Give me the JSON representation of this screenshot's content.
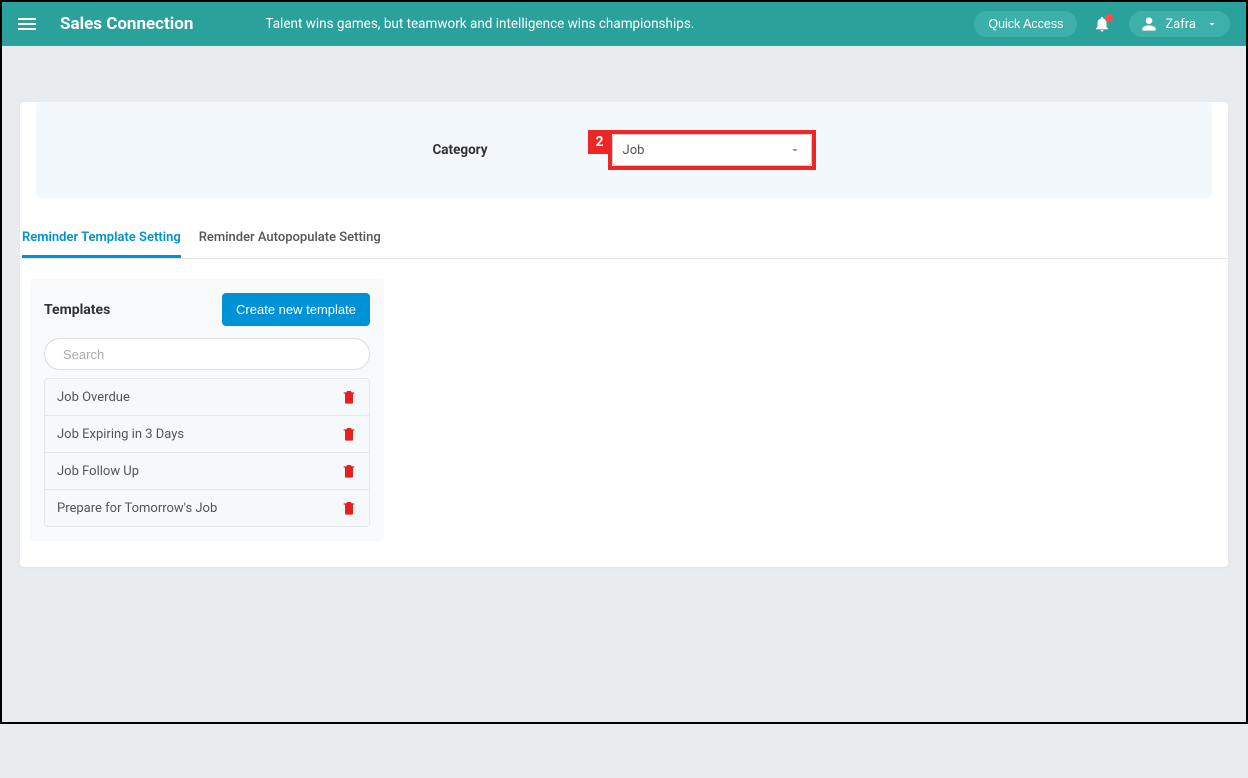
{
  "header": {
    "brand": "Sales Connection",
    "tagline": "Talent wins games, but teamwork and intelligence wins championships.",
    "quick_access_label": "Quick Access",
    "user_name": "Zafra"
  },
  "category_section": {
    "label": "Category",
    "selected_value": "Job",
    "callout_number": "2"
  },
  "tabs": [
    {
      "label": "Reminder Template Setting",
      "active": true
    },
    {
      "label": "Reminder Autopopulate Setting",
      "active": false
    }
  ],
  "templates_panel": {
    "title": "Templates",
    "create_button_label": "Create new template",
    "search_placeholder": "Search",
    "items": [
      {
        "name": "Job Overdue"
      },
      {
        "name": "Job Expiring in 3 Days"
      },
      {
        "name": "Job Follow Up"
      },
      {
        "name": "Prepare for Tomorrow's Job"
      }
    ]
  }
}
